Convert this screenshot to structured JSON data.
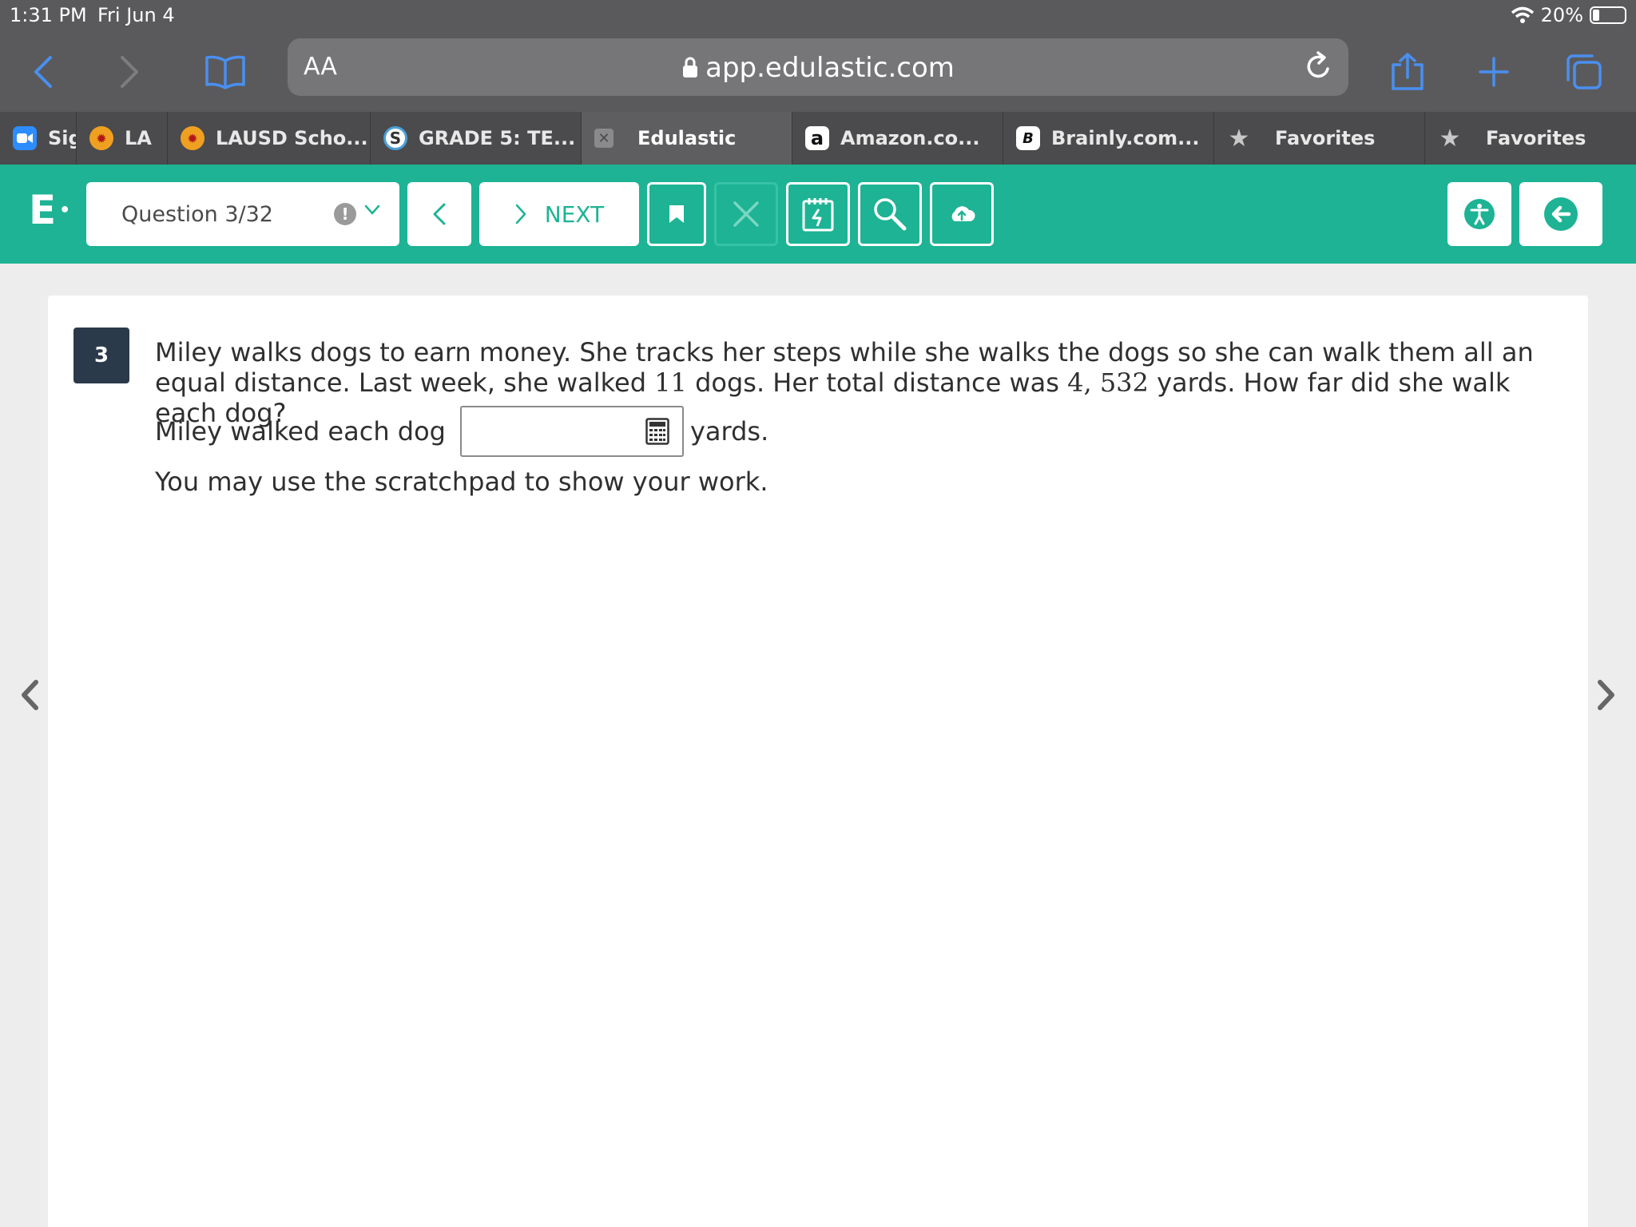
{
  "status_bar": {
    "time": "1:31 PM",
    "date": "Fri Jun 4",
    "battery": "20%",
    "battery_level": 0.2
  },
  "browser": {
    "address_aa": "AA",
    "url": "app.edulastic.com",
    "tabs": [
      {
        "label": "Sig",
        "icon": "zoom-video-icon"
      },
      {
        "label": "LA",
        "icon": "lausd-icon"
      },
      {
        "label": "LAUSD Scho...",
        "icon": "lausd-icon"
      },
      {
        "label": "GRADE 5: TE...",
        "icon": "schoology-icon"
      },
      {
        "label": "Edulastic",
        "icon": "close-tab-icon"
      },
      {
        "label": "Amazon.co...",
        "icon": "amazon-icon"
      },
      {
        "label": "Brainly.com...",
        "icon": "brainly-icon"
      },
      {
        "label": "Favorites",
        "icon": "star-icon"
      },
      {
        "label": "Favorites",
        "icon": "star-icon"
      }
    ]
  },
  "header": {
    "logo": "E",
    "question_selector": "Question 3/32",
    "next_label": "NEXT",
    "accent": "#1db394"
  },
  "question": {
    "number": "3",
    "sentence1": "Miley walks dogs to earn money.  She tracks her steps while she walks the dogs so she can walk them all an equal distance.    Last week, she walked ",
    "dogs_count": "11",
    "sentence2": "  dogs.  Her total distance was ",
    "total_distance": "4, 532",
    "sentence3": "  yards. How far did she walk each dog?",
    "answer_prefix": "Miley walked each dog",
    "answer_value": "",
    "answer_suffix": "yards.",
    "scratchpad_note": "You may use the scratchpad to show your work."
  }
}
